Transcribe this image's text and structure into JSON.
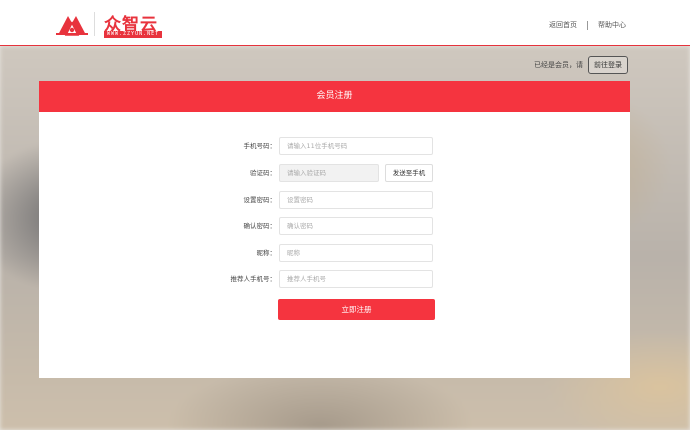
{
  "brand": {
    "name": "众智云",
    "url_text": "WWW.ZZYUN.NET",
    "color": "#e8333d"
  },
  "top_nav": {
    "home": "返回首页",
    "help": "帮助中心"
  },
  "member": {
    "prompt": "已经是会员，请",
    "login_button": "前往登录"
  },
  "panel": {
    "title": "会员注册"
  },
  "form": {
    "phone": {
      "label": "手机号码：",
      "placeholder": "请输入11位手机号码"
    },
    "code": {
      "label": "验证码：",
      "placeholder": "请输入验证码",
      "send_button": "发送至手机"
    },
    "password": {
      "label": "设置密码：",
      "placeholder": "设置密码"
    },
    "confirm": {
      "label": "确认密码：",
      "placeholder": "确认密码"
    },
    "nickname": {
      "label": "昵称：",
      "placeholder": "昵称"
    },
    "referrer": {
      "label": "推荐人手机号：",
      "placeholder": "推荐人手机号"
    },
    "submit_button": "立即注册"
  },
  "colors": {
    "accent": "#f5343f"
  }
}
